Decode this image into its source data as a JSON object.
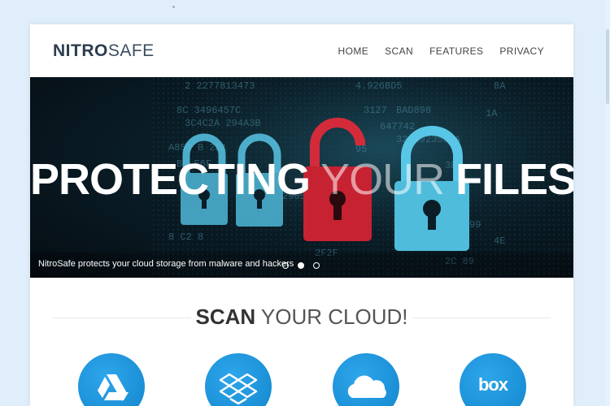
{
  "brand": {
    "bold": "NITRO",
    "light": "SAFE"
  },
  "nav": [
    "HOME",
    "SCAN",
    "FEATURES",
    "PRIVACY"
  ],
  "hero": {
    "title_bold_1": "PROTECTING",
    "title_light": "YOUR",
    "title_bold_2": "FILES",
    "caption": "NitroSafe protects your cloud storage from malware and hackers",
    "slide_count": 3,
    "active_slide": 2
  },
  "scan": {
    "bold": "SCAN",
    "light": "YOUR CLOUD!"
  },
  "services": [
    "google-drive-icon",
    "dropbox-icon",
    "onedrive-icon",
    "box-icon"
  ],
  "box_label": "box",
  "colors": {
    "accent": "#1a8fd6",
    "lock_blue": "#58c6e6",
    "lock_red": "#d42b3b",
    "text_dark": "#2b3d4f"
  }
}
